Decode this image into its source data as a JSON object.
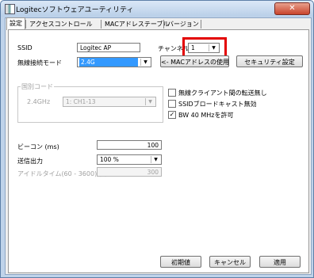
{
  "window": {
    "title": "Logitecソフトウェアユーティリティ",
    "close_label": "✕"
  },
  "tabs": [
    "設定",
    "アクセスコントロール",
    "MACアドレステーブル",
    "バージョン"
  ],
  "form": {
    "ssid_label": "SSID",
    "ssid_value": "Logitec AP",
    "mode_label": "無線接続モード",
    "mode_value": "2.4G",
    "channel_label": "チャンネル",
    "channel_value": "1",
    "mac_button": "<- MACアドレスの使用",
    "security_button": "セキュリティ設定"
  },
  "domain_group": {
    "title": "国別コード",
    "band_label": "2.4GHz",
    "band_value": "1: CH1-13"
  },
  "options": [
    {
      "label": "無線クライアント間の転送無し",
      "checked": false
    },
    {
      "label": "SSIDブロードキャスト無効",
      "checked": false
    },
    {
      "label": "BW 40 MHzを許可",
      "checked": true
    }
  ],
  "beacon": {
    "label": "ビーコン (ms)",
    "value": "100"
  },
  "tx_power": {
    "label": "送信出力",
    "value": "100 %"
  },
  "idle_time": {
    "label": "アイドルタイム(60 - 3600) (s)",
    "value": "300"
  },
  "buttons": {
    "default": "初期値",
    "cancel": "キャンセル",
    "apply": "適用"
  },
  "colors": {
    "highlight": "#e30000",
    "selection": "#3399ff"
  }
}
